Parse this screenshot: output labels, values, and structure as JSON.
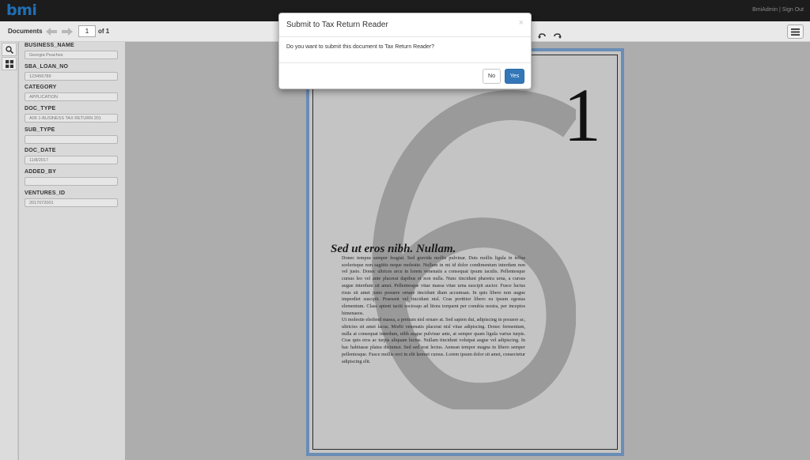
{
  "app": {
    "logo": "bmi",
    "user": "BmiAdmin",
    "separator": " | ",
    "sign_out": "Sign Out"
  },
  "toolbar": {
    "label": "Documents",
    "page_current": "1",
    "page_total": "of 1"
  },
  "fields": [
    {
      "label": "BUSINESS_NAME",
      "value": "Georgia Peaches"
    },
    {
      "label": "SBA_LOAN_NO",
      "value": "123456789"
    },
    {
      "label": "CATEGORY",
      "value": "APPLICATION"
    },
    {
      "label": "DOC_TYPE",
      "value": "A06 1-BUSINESS TAX RETURN 201"
    },
    {
      "label": "SUB_TYPE",
      "value": ""
    },
    {
      "label": "DOC_DATE",
      "value": "11/8/2017"
    },
    {
      "label": "ADDED_BY",
      "value": ""
    },
    {
      "label": "VENTURES_ID",
      "value": "2017072001"
    }
  ],
  "document": {
    "big_number": "1",
    "heading": "Sed ut eros nibh. Nullam.",
    "paragraph1": "Donec tempus semper feugiat. Sed gravida mollis pulvinar. Duis mollis ligula in tellus scelerisque non sagittis neque molestie. Nullam in mi id dolor condimentum interdum non vel justo. Donec ultrices arcu in lorem venenatis a consequat ipsum iaculis. Pellentesque cursus leo vel ante placerat dapibus et non nulla. Nunc tincidunt pharetra urna, a cursus augue interdum sit amet. Pellentesque vitae massa vitae urna suscipit auctor. Fusce luctus risus sit amet justo posuere ornare tincidunt diam accumsan. In quis libero non augue imperdiet suscipit. Praesent vel tincidunt nisl. Cras porttitor libero eu ipsum egestas elementum. Class aptent taciti sociosqu ad litora torquent per conubia nostra, per inceptos himenaeos.",
    "paragraph2": "Ut molestie eleifend massa, a pretium nisl ornare at. Sed sapien dui, adipiscing in posuere ac, ultricies sit amet lacus. Morbi venenatis placerat nisl vitae adipiscing. Donec fermentum, nulla at consequat interdum, nibh augue pulvinar ante, at semper quam ligula varius turpis. Cras quis eros ac turpis aliquam luctus. Nullam tincidunt volutpat augue vel adipiscing. In hac habitasse platea dictumst. Sed sed erat lectus. Aenean tempor magna in libero semper pellentesque. Fusce mollis orci in elit laoreet cursus. Lorem ipsum dolor sit amet, consectetur adipiscing elit."
  },
  "modal": {
    "title": "Submit to Tax Return Reader",
    "close": "×",
    "message": "Do you want to submit this document to Tax Return Reader?",
    "no_label": "No",
    "yes_label": "Yes"
  },
  "colors": {
    "primary": "#3377b8",
    "logo": "#1f6fb4",
    "topbar": "#1c1c1c"
  }
}
